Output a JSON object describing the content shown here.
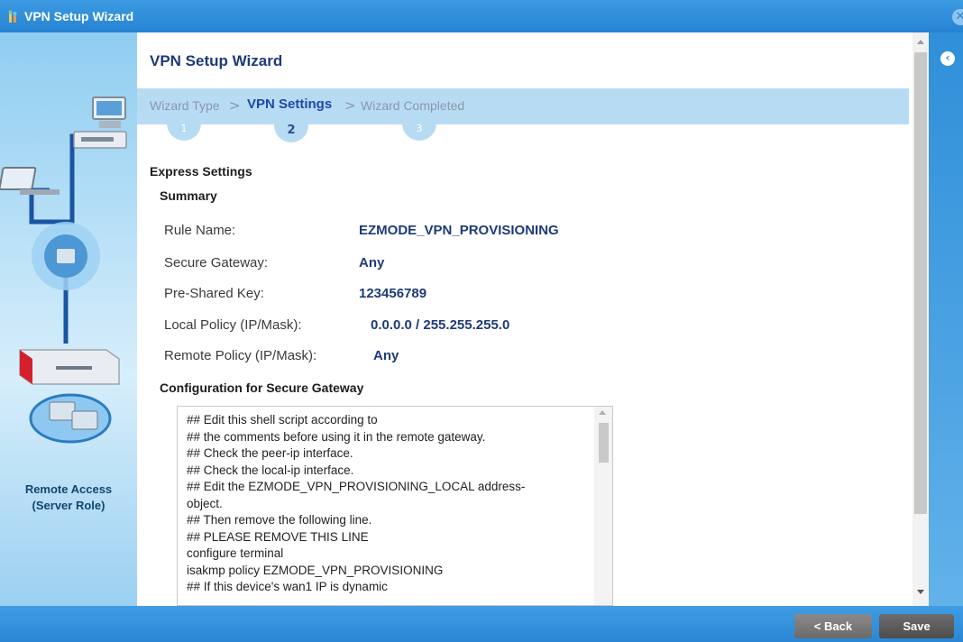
{
  "window": {
    "title": "VPN Setup Wizard"
  },
  "sidebar": {
    "role_line1": "Remote Access",
    "role_line2": "(Server Role)"
  },
  "main": {
    "page_title": "VPN Setup Wizard",
    "steps": [
      {
        "label": "Wizard Type",
        "number": "1",
        "active": false
      },
      {
        "label": "VPN Settings",
        "number": "2",
        "active": true
      },
      {
        "label": "Wizard Completed",
        "number": "3",
        "active": false
      }
    ],
    "express_heading": "Express Settings",
    "summary_heading": "Summary",
    "summary_rows": [
      {
        "label": "Rule Name:",
        "value": "EZMODE_VPN_PROVISIONING"
      },
      {
        "label": "Secure Gateway:",
        "value": "Any"
      },
      {
        "label": "Pre-Shared Key:",
        "value": "123456789"
      },
      {
        "label": "Local Policy (IP/Mask):",
        "value": "0.0.0.0 / 255.255.255.0"
      },
      {
        "label": "Remote Policy (IP/Mask):",
        "value": "Any"
      }
    ],
    "config_heading": "Configuration for Secure Gateway",
    "script_lines": [
      "## Edit this shell script according to",
      "## the comments before using it in the remote gateway.",
      "## Check the peer-ip interface.",
      "## Check the local-ip interface.",
      "## Edit the EZMODE_VPN_PROVISIONING_LOCAL address-",
      "object.",
      "## Then remove the following line.",
      "## PLEASE REMOVE THIS LINE",
      "configure terminal",
      "isakmp policy EZMODE_VPN_PROVISIONING",
      "## If this device's wan1 IP is dynamic"
    ]
  },
  "footer": {
    "back_label": "< Back",
    "save_label": "Save"
  },
  "colors": {
    "titlebar": "#2583d2",
    "accent_text": "#1e3b78",
    "steps_bar": "#b8dbf4"
  }
}
